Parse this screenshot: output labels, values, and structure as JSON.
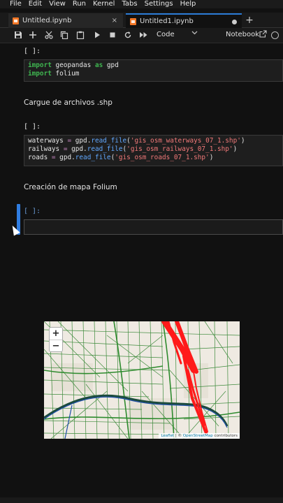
{
  "menubar": {
    "items": [
      "File",
      "Edit",
      "View",
      "Run",
      "Kernel",
      "Tabs",
      "Settings",
      "Help"
    ]
  },
  "tabs": [
    {
      "label": "Untitled.ipynb",
      "close": "×"
    },
    {
      "label": "Untitled1.ipynb"
    }
  ],
  "newtab": "+",
  "toolbar": {
    "cell_type": "Code",
    "kernel": "Notebook",
    "icons": [
      "save-icon",
      "add-icon",
      "cut-icon",
      "copy-icon",
      "paste-icon",
      "run-icon",
      "stop-icon",
      "restart-icon",
      "fast-forward-icon",
      "chevron-down-icon",
      "external-link-icon",
      "kernel-status-icon"
    ]
  },
  "cells": {
    "c1": {
      "prompt": "[ ]:"
    },
    "m1": {
      "text": "Cargue de archivos .shp"
    },
    "c2": {
      "prompt": "[ ]:"
    },
    "m2": {
      "text": "Creación de mapa Folium"
    },
    "c3": {
      "prompt": "[ ]:"
    }
  },
  "code": {
    "import_kw": "import",
    "geopandas": " geopandas ",
    "as_kw": "as",
    "gpd": " gpd",
    "folium": " folium",
    "waterways": "waterways",
    "railways": "railways ",
    "roads": "roads ",
    "eq": "=",
    "gpd_read": " gpd.",
    "read_file": "read_file",
    "paren_open": "(",
    "paren_close": ")",
    "file_waterways": "'gis_osm_waterways_07_1.shp'",
    "file_railways": "'gis_osm_railways_07_1.shp'",
    "file_roads": "'gis_osm_roads_07_1.shp'"
  },
  "map": {
    "zoom_in": "+",
    "zoom_out": "−",
    "attribution_leaflet": "Leaflet",
    "attribution_sep": " | © ",
    "attribution_osm": "OpenStreetMap",
    "attribution_end": " contributors",
    "colors": {
      "roads": "#1f7a1f",
      "railways": "#ff1a1a",
      "waterways": "#1f4fa8",
      "base": "#efeae2"
    }
  }
}
